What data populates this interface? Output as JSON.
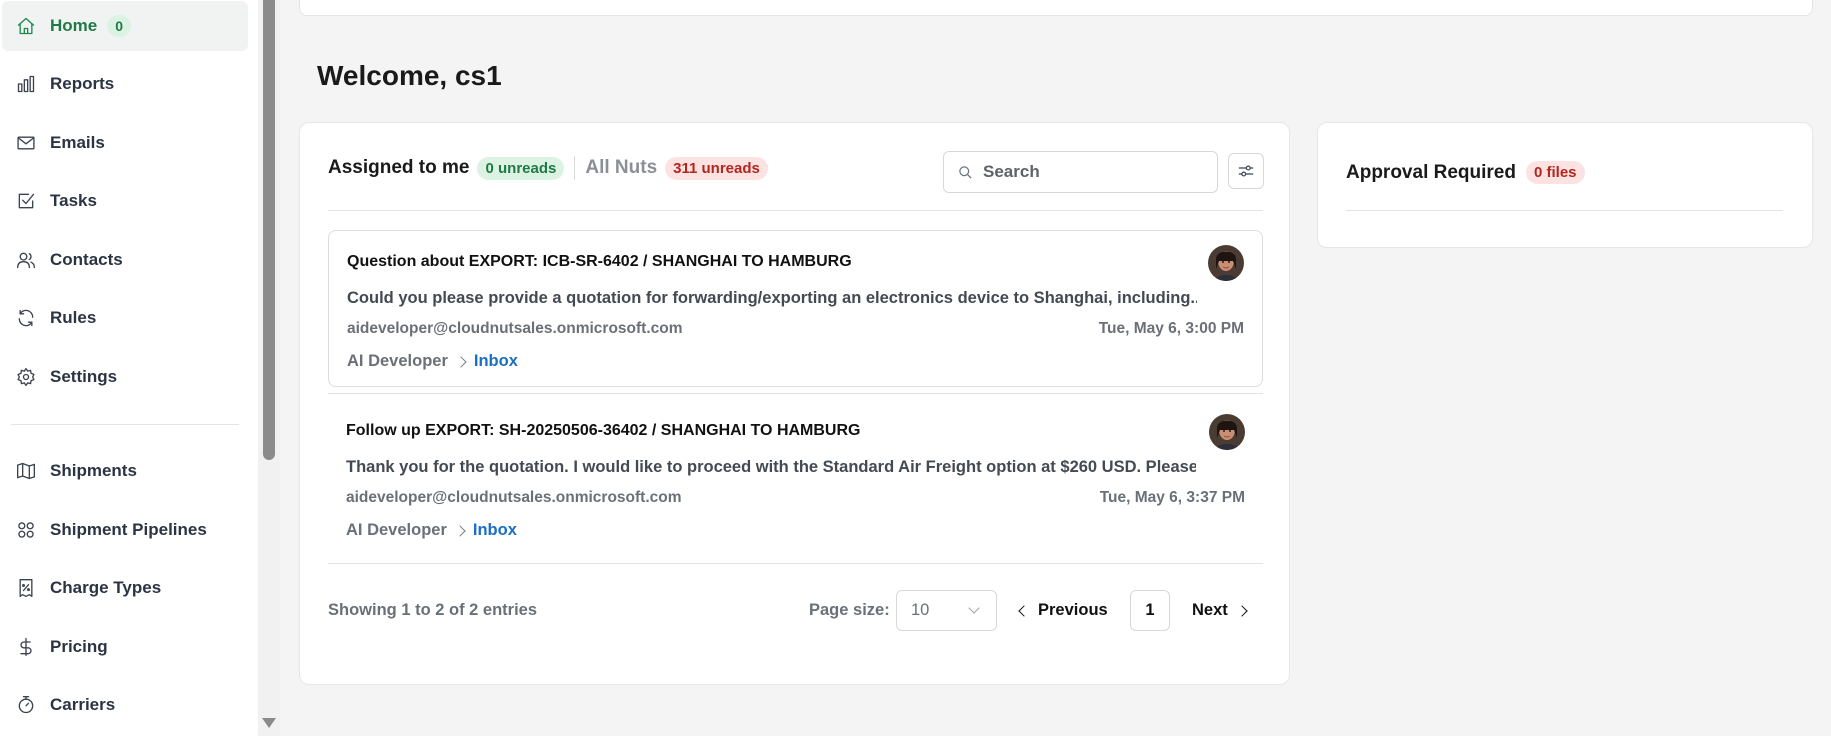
{
  "sidebar": {
    "items": [
      {
        "label": "Home",
        "badge": "0",
        "icon": "home-icon"
      },
      {
        "label": "Reports",
        "icon": "bar-chart-icon"
      },
      {
        "label": "Emails",
        "icon": "mail-icon"
      },
      {
        "label": "Tasks",
        "icon": "checkbox-icon"
      },
      {
        "label": "Contacts",
        "icon": "users-icon"
      },
      {
        "label": "Rules",
        "icon": "refresh-icon"
      },
      {
        "label": "Settings",
        "icon": "gear-icon"
      },
      {
        "label": "Shipments",
        "icon": "map-icon"
      },
      {
        "label": "Shipment Pipelines",
        "icon": "grid-icon"
      },
      {
        "label": "Charge Types",
        "icon": "receipt-icon"
      },
      {
        "label": "Pricing",
        "icon": "dollar-icon"
      },
      {
        "label": "Carriers",
        "icon": "stopwatch-icon"
      }
    ]
  },
  "main": {
    "welcome": "Welcome, cs1",
    "tabs": [
      {
        "label": "Assigned to me",
        "badge": "0 unreads"
      },
      {
        "label": "All Nuts",
        "badge": "311 unreads"
      }
    ],
    "search": {
      "placeholder": "Search"
    },
    "emails": [
      {
        "subject": "Question about EXPORT: ICB-SR-6402 / SHANGHAI TO HAMBURG",
        "preview": "Could you please provide a quotation for forwarding/exporting an electronics device to Shanghai, including...",
        "from": "aideveloper@cloudnutsales.onmicrosoft.com",
        "date": "Tue, May 6, 3:00 PM",
        "account": "AI Developer",
        "folder": "Inbox"
      },
      {
        "subject": "Follow up EXPORT: SH-20250506-36402 / SHANGHAI TO HAMBURG",
        "preview": "Thank you for the quotation. I would like to proceed with the Standard Air Freight option at $260 USD. Please...",
        "from": "aideveloper@cloudnutsales.onmicrosoft.com",
        "date": "Tue, May 6, 3:37 PM",
        "account": "AI Developer",
        "folder": "Inbox"
      }
    ],
    "pagination": {
      "showing": "Showing 1 to 2 of 2 entries",
      "page_size_label": "Page size:",
      "page_size": "10",
      "previous": "Previous",
      "current_page": "1",
      "next": "Next"
    }
  },
  "approval": {
    "title": "Approval Required",
    "badge": "0 files"
  },
  "colors": {
    "accent_green": "#1f7a45",
    "accent_red": "#b3261e",
    "link_blue": "#1a6fc4"
  }
}
